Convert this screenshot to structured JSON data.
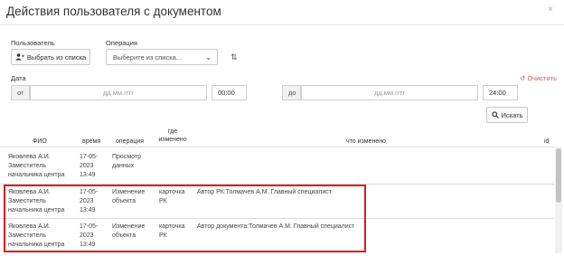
{
  "dialog": {
    "title": "Действия пользователя с документом",
    "close": "×"
  },
  "filters": {
    "user_label": "Пользователь",
    "choose_button": "Выбрать из списка",
    "operation_label": "Операция",
    "operation_placeholder": "Выберите из списка...",
    "date_label": "Дата",
    "clear_label": "Очистить",
    "from_label": "от",
    "to_label": "до",
    "date_placeholder": "дд.мм.гггг",
    "from_time": "00:00",
    "to_time": "24:00",
    "search_button": "Искать"
  },
  "icons": {
    "user": "user-plus-icon",
    "sort": "sort-icon",
    "clear": "undo-icon",
    "search": "search-icon",
    "chevron": "chevron-down-icon"
  },
  "table": {
    "headers": {
      "fio": "ФИО",
      "time": "время",
      "operation": "операция",
      "where_1": "где",
      "where_2": "изменено",
      "what": "что изменено",
      "id": "id"
    },
    "rows": [
      {
        "fio": [
          "Яковлева А.И.",
          "Заместитель",
          "начальника центра"
        ],
        "time": [
          "17-05-",
          "2023",
          "13:49"
        ],
        "operation": [
          "Просмотр",
          "данных"
        ],
        "where": [
          "",
          ""
        ],
        "what": ""
      },
      {
        "fio": [
          "Яковлева А.И.",
          "Заместитель",
          "начальника центра"
        ],
        "time": [
          "17-05-",
          "2023",
          "13:49"
        ],
        "operation": [
          "Изменение",
          "объекта"
        ],
        "where": [
          "карточка",
          "РК"
        ],
        "what": "Автор РК:Толмачев А.М. Главный специалист"
      },
      {
        "fio": [
          "Яковлева А.И.",
          "Заместитель",
          "начальника центра"
        ],
        "time": [
          "17-05-",
          "2023",
          "13:49"
        ],
        "operation": [
          "Изменение",
          "объекта"
        ],
        "where": [
          "карточка",
          "РК"
        ],
        "what": "Автор документа:Толмачев А.М. Главный специалист"
      }
    ]
  },
  "colors": {
    "highlight": "#e01b1b",
    "clear": "#d9534f"
  }
}
